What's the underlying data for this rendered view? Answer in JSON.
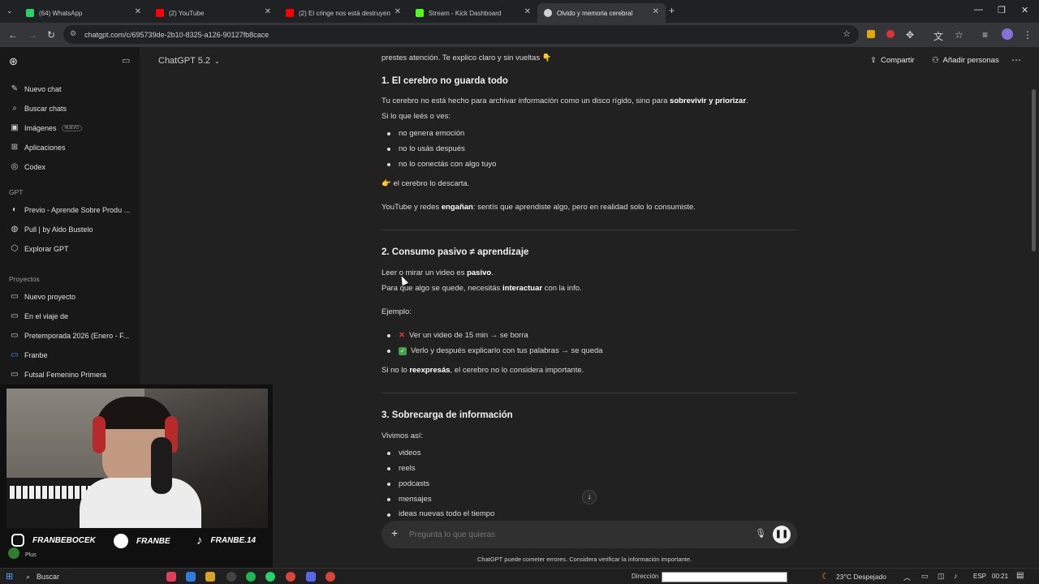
{
  "browser": {
    "tabs": [
      {
        "label": "(64) WhatsApp",
        "color": "#25d366"
      },
      {
        "label": "(2) YouTube",
        "color": "#ff0000"
      },
      {
        "label": "(2) El cringe nos está destruyen",
        "color": "#ff0000"
      },
      {
        "label": "Stream - Kick Dashboard",
        "color": "#53fc18"
      },
      {
        "label": "Olvido y memoria cerebral",
        "color": "#cccccc"
      }
    ],
    "url": "chatgpt.com/c/695739de-2b10-8325-a126-90127fb8cace"
  },
  "sidebar": {
    "items": [
      {
        "label": "Nuevo chat",
        "icon": "edit-icon"
      },
      {
        "label": "Buscar chats",
        "icon": "search-icon"
      },
      {
        "label": "Imágenes",
        "icon": "image-icon",
        "badge": "NUEVO"
      },
      {
        "label": "Aplicaciones",
        "icon": "apps-icon"
      },
      {
        "label": "Codex",
        "icon": "codex-icon"
      }
    ],
    "gpt_section": "GPT",
    "gpts": [
      {
        "label": "Previo - Aprende Sobre Produ ..."
      },
      {
        "label": "Pull | by Aldo Bustelo"
      },
      {
        "label": "Explorar GPT"
      }
    ],
    "projects_section": "Proyectos",
    "projects": [
      {
        "label": "Nuevo proyecto"
      },
      {
        "label": "En el viaje de"
      },
      {
        "label": "Pretemporada 2026 (Enero - F..."
      },
      {
        "label": "Franbe"
      },
      {
        "label": "Futsal Femenino Primera"
      }
    ],
    "plan": "Plus"
  },
  "header": {
    "model": "ChatGPT 5.2",
    "share": "Compartir",
    "add_people": "Añadir personas"
  },
  "content": {
    "intro": "prestes atención. Te explico claro y sin vueltas 👇",
    "s1_title": "1. El cerebro no guarda todo",
    "s1_p1a": "Tu cerebro no está hecho para archivar información como un disco rígido, sino para ",
    "s1_p1b": "sobrevivir y priorizar",
    "s1_p1c": ".",
    "s1_p2": "Si lo que leés o ves:",
    "s1_list": [
      "no genera emoción",
      "no lo usás después",
      "no lo conectás con algo tuyo"
    ],
    "s1_point": "👉 el cerebro lo descarta.",
    "s1_p3a": "YouTube y redes ",
    "s1_p3b": "engañan",
    "s1_p3c": ": sentís que aprendiste algo, pero en realidad solo lo consumiste.",
    "s2_title": "2. Consumo pasivo ≠ aprendizaje",
    "s2_p1a": "Leer o mirar un video es ",
    "s2_p1b": "pasivo",
    "s2_p1c": ".",
    "s2_p2a": "Para que algo se quede, necesitás ",
    "s2_p2b": "interactuar",
    "s2_p2c": " con la info.",
    "s2_example": "Ejemplo:",
    "s2_list": [
      "Ver un video de 15 min → se borra",
      "Verlo y después explicarlo con tus palabras → se queda"
    ],
    "s2_p3a": "Si no lo ",
    "s2_p3b": "reexpresás",
    "s2_p3c": ", el cerebro no lo considera importante.",
    "s3_title": "3. Sobrecarga de información",
    "s3_p1": "Vivimos así:",
    "s3_list": [
      "videos",
      "reels",
      "podcasts",
      "mensajes",
      "ideas nuevas todo el tiempo"
    ]
  },
  "composer": {
    "placeholder": "Pregunta lo que quieras",
    "disclaimer": "ChatGPT puede cometer errores. Considera verificar la información importante."
  },
  "overlay": {
    "instagram": "FRANBEBOCEK",
    "spotify": "FRANBE",
    "tiktok": "FRANBE.14"
  },
  "taskbar": {
    "search": "Buscar",
    "weather": "23°C  Despejado",
    "direccion": "Dirección",
    "lang": "ESP",
    "time": "00:21"
  }
}
